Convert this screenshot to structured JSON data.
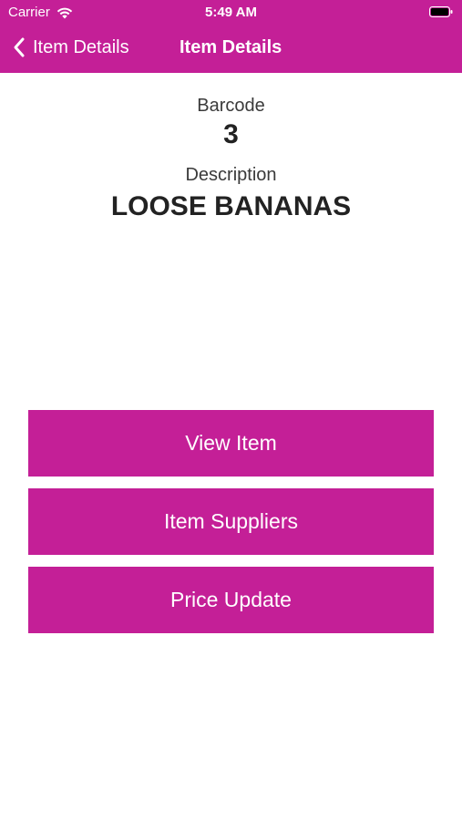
{
  "status_bar": {
    "carrier": "Carrier",
    "time": "5:49 AM"
  },
  "nav": {
    "back_label": "Item Details",
    "title": "Item Details"
  },
  "item": {
    "barcode_label": "Barcode",
    "barcode_value": "3",
    "description_label": "Description",
    "description_value": "LOOSE BANANAS"
  },
  "actions": {
    "view_item": "View Item",
    "item_suppliers": "Item Suppliers",
    "price_update": "Price Update"
  },
  "colors": {
    "brand": "#c41f97",
    "text": "#222222"
  },
  "icons": {
    "back": "chevron-left-icon",
    "wifi": "wifi-icon",
    "battery": "battery-icon"
  }
}
